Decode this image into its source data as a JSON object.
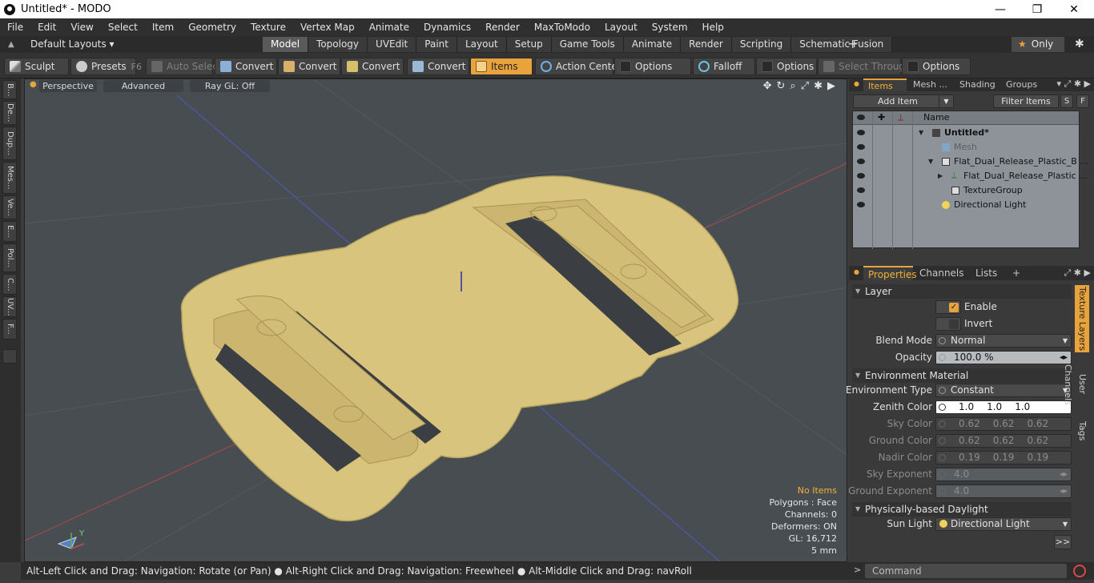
{
  "window": {
    "title": "Untitled* - MODO",
    "minimize_glyph": "—",
    "maximize_glyph": "❐",
    "close_glyph": "✕"
  },
  "menu": [
    "File",
    "Edit",
    "View",
    "Select",
    "Item",
    "Geometry",
    "Texture",
    "Vertex Map",
    "Animate",
    "Dynamics",
    "Render",
    "MaxToModo",
    "Layout",
    "System",
    "Help"
  ],
  "layoutbar": {
    "default_layouts": "Default Layouts ▾",
    "tabs": [
      "Model",
      "Topology",
      "UVEdit",
      "Paint",
      "Layout",
      "Setup",
      "Game Tools",
      "Animate",
      "Render",
      "Scripting",
      "Schematic Fusion"
    ],
    "active_tab": "Model",
    "add_glyph": "+",
    "only_label": "Only",
    "star_glyph": "★",
    "gear_glyph": "✱"
  },
  "toolbar": {
    "sculpt": "Sculpt",
    "presets": "Presets",
    "presets_key": "F6",
    "auto_select": "Auto Select",
    "convert1": "Convert",
    "convert2": "Convert",
    "convert3": "Convert",
    "convert4": "Convert",
    "items": "Items",
    "action_center": "Action Center",
    "options1": "Options",
    "falloff": "Falloff",
    "options2": "Options",
    "select_through": "Select Through",
    "options3": "Options"
  },
  "lefttabs": [
    "B...",
    "De...",
    "Dup...",
    "Mes...",
    "Ve...",
    "E...",
    "Pol...",
    "C...",
    "UV...",
    "F..."
  ],
  "viewport": {
    "perspective": "Perspective",
    "advanced": "Advanced",
    "raygl": "Ray GL: Off",
    "hud": {
      "no_items": "No Items",
      "polygons": "Polygons : Face",
      "channels": "Channels: 0",
      "deformers": "Deformers: ON",
      "gl": "GL: 16,712",
      "scale": "5 mm"
    },
    "axis_y": "Y",
    "nav_icons": [
      "✥",
      "↻",
      "⌕",
      "⤢",
      "✱",
      "▶"
    ]
  },
  "statusbar": {
    "text": "Alt-Left Click and Drag: Navigation: Rotate (or Pan) ● Alt-Right Click and Drag: Navigation: Freewheel ● Alt-Middle Click and Drag: navRoll"
  },
  "itemlist": {
    "tabs": [
      "Items",
      "Mesh ...",
      "Shading",
      "Groups"
    ],
    "add_item": "Add Item",
    "filter_items": "Filter Items",
    "s_btn": "S",
    "f_btn": "F",
    "column_name": "Name",
    "rows": [
      {
        "label": "Untitled*",
        "indent": 0
      },
      {
        "label": "Mesh",
        "indent": 1
      },
      {
        "label": "Flat_Dual_Release_Plastic_B ...",
        "indent": 1
      },
      {
        "label": "Flat_Dual_Release_Plastic ...",
        "indent": 2
      },
      {
        "label": "TextureGroup",
        "indent": 2
      },
      {
        "label": "Directional Light",
        "indent": 1
      }
    ]
  },
  "properties": {
    "tabs": [
      "Properties",
      "Channels",
      "Lists",
      "+"
    ],
    "sections": {
      "layer": "Layer",
      "env": "Environment Material",
      "daylight": "Physically-based Daylight"
    },
    "enable": "Enable",
    "invert": "Invert",
    "blend_mode_label": "Blend Mode",
    "blend_mode": "Normal",
    "opacity_label": "Opacity",
    "opacity": "100.0 %",
    "env_type_label": "Environment Type",
    "env_type": "Constant",
    "zenith_label": "Zenith Color",
    "zenith": [
      "1.0",
      "1.0",
      "1.0"
    ],
    "sky_label": "Sky Color",
    "sky": [
      "0.62",
      "0.62",
      "0.62"
    ],
    "ground_label": "Ground Color",
    "ground": [
      "0.62",
      "0.62",
      "0.62"
    ],
    "nadir_label": "Nadir Color",
    "nadir": [
      "0.19",
      "0.19",
      "0.19"
    ],
    "sky_exp_label": "Sky Exponent",
    "sky_exp": "4.0",
    "ground_exp_label": "Ground Exponent",
    "ground_exp": "4.0",
    "sun_light_label": "Sun Light",
    "sun_light": "Directional Light",
    "more": ">>",
    "side_tabs": [
      "Texture Layers",
      "User Channels",
      "Tags"
    ]
  },
  "command": {
    "placeholder": "Command",
    "prompt": ">"
  },
  "colors": {
    "accent": "#e8a33c",
    "model": "#d9c47e",
    "viewport_bg": "#484d52"
  }
}
